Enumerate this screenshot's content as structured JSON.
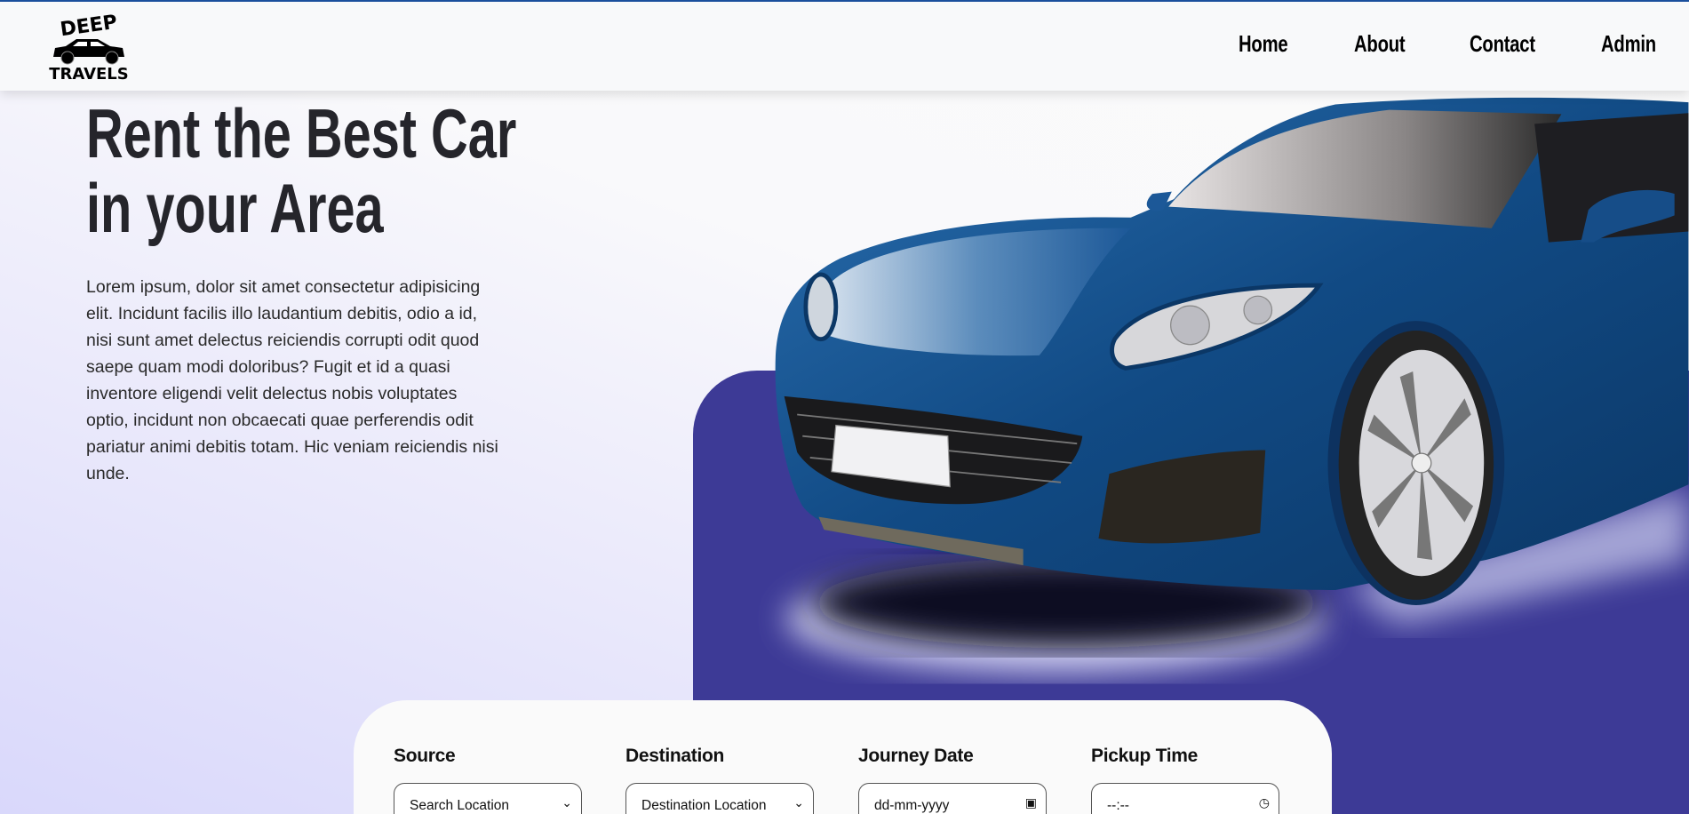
{
  "brand": {
    "logo_top": "DEEP",
    "logo_bottom": "TRAVELS"
  },
  "nav": {
    "items": [
      {
        "label": "Home"
      },
      {
        "label": "About"
      },
      {
        "label": "Contact"
      },
      {
        "label": "Admin"
      }
    ]
  },
  "hero": {
    "title_line1": "Rent the Best Car",
    "title_line2": "in your Area",
    "description": "Lorem ipsum, dolor sit amet consectetur adipisicing elit. Incidunt facilis illo laudantium debitis, odio a id, nisi sunt amet delectus reiciendis corrupti odit quod saepe quam modi doloribus? Fugit et id a quasi inventore eligendi velit delectus nobis voluptates optio, incidunt non obcaecati quae perferendis odit pariatur animi debitis totam. Hic veniam reiciendis nisi unde."
  },
  "booking": {
    "source": {
      "label": "Source",
      "value": "Search Location"
    },
    "destination": {
      "label": "Destination",
      "value": "Destination Location"
    },
    "date": {
      "label": "Journey Date",
      "placeholder": "dd-mm-yyyy"
    },
    "time": {
      "label": "Pickup Time",
      "placeholder": "--:--"
    }
  },
  "colors": {
    "accent": "#3d3a96",
    "topline": "#1a4f9c",
    "car": "#1e5b9c"
  }
}
